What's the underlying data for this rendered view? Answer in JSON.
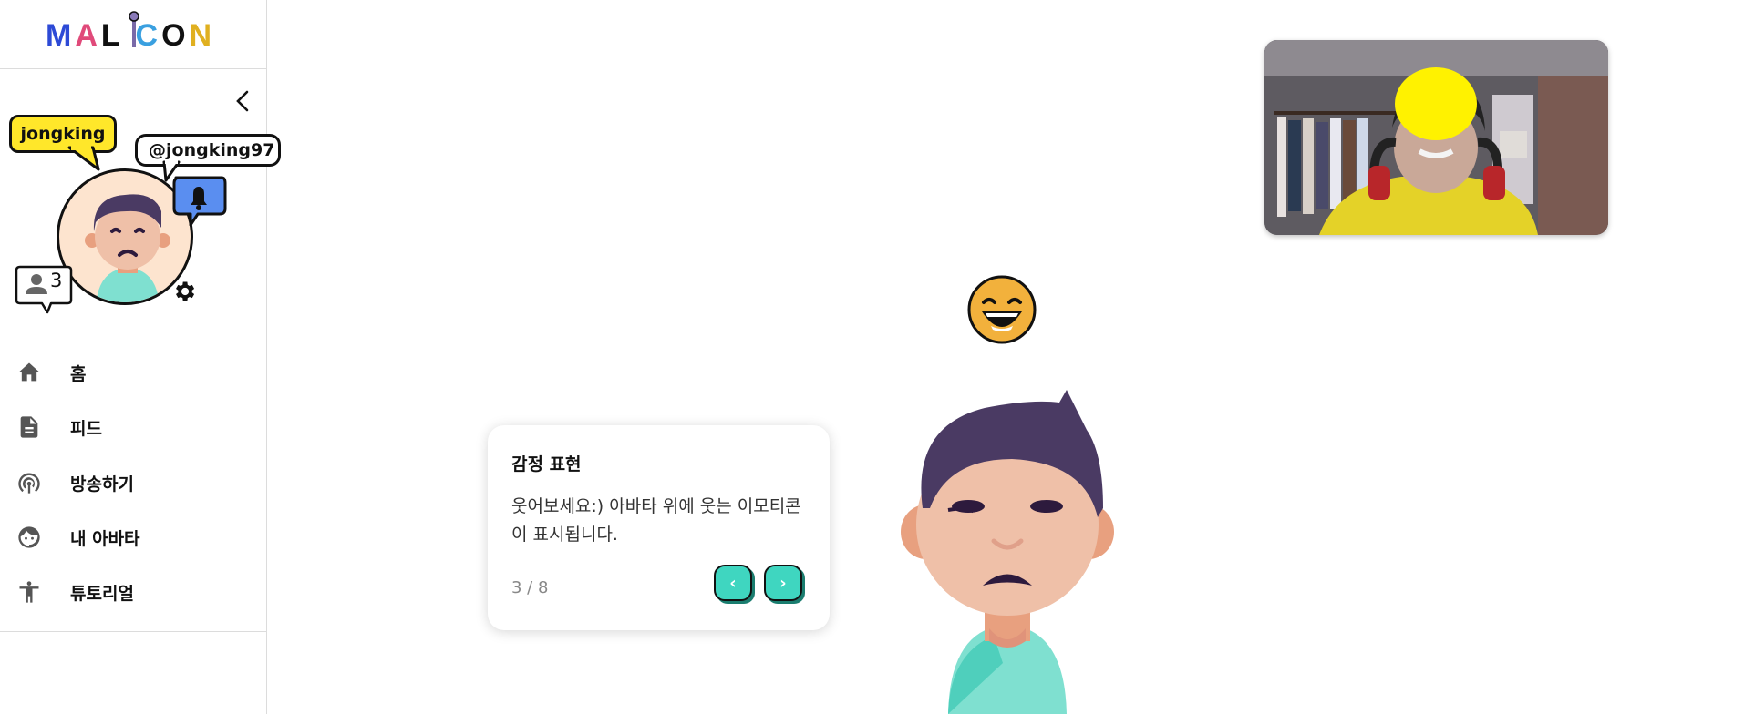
{
  "app": {
    "logo_text": "MALICON"
  },
  "profile": {
    "name": "jongking",
    "handle": "@jongking97",
    "followers": "3"
  },
  "nav": {
    "items": [
      {
        "label": "홈",
        "icon": "home-icon"
      },
      {
        "label": "피드",
        "icon": "feed-icon"
      },
      {
        "label": "방송하기",
        "icon": "broadcast-icon"
      },
      {
        "label": "내 아바타",
        "icon": "avatar-face-icon"
      },
      {
        "label": "튜토리얼",
        "icon": "accessibility-icon"
      }
    ]
  },
  "tutorial": {
    "title": "감정 표현",
    "body": "웃어보세요:) 아바타 위에 웃는 이모티콘이 표시됩니다.",
    "page": "3 / 8",
    "prev_label": "‹",
    "next_label": "›"
  },
  "colors": {
    "accent": "#3fd6c0",
    "name_bubble": "#ffe72a",
    "bell_bubble": "#5a8ef0",
    "hair": "#4a3a63",
    "skin": "#efc0a8",
    "shirt": "#7fe0d0"
  }
}
